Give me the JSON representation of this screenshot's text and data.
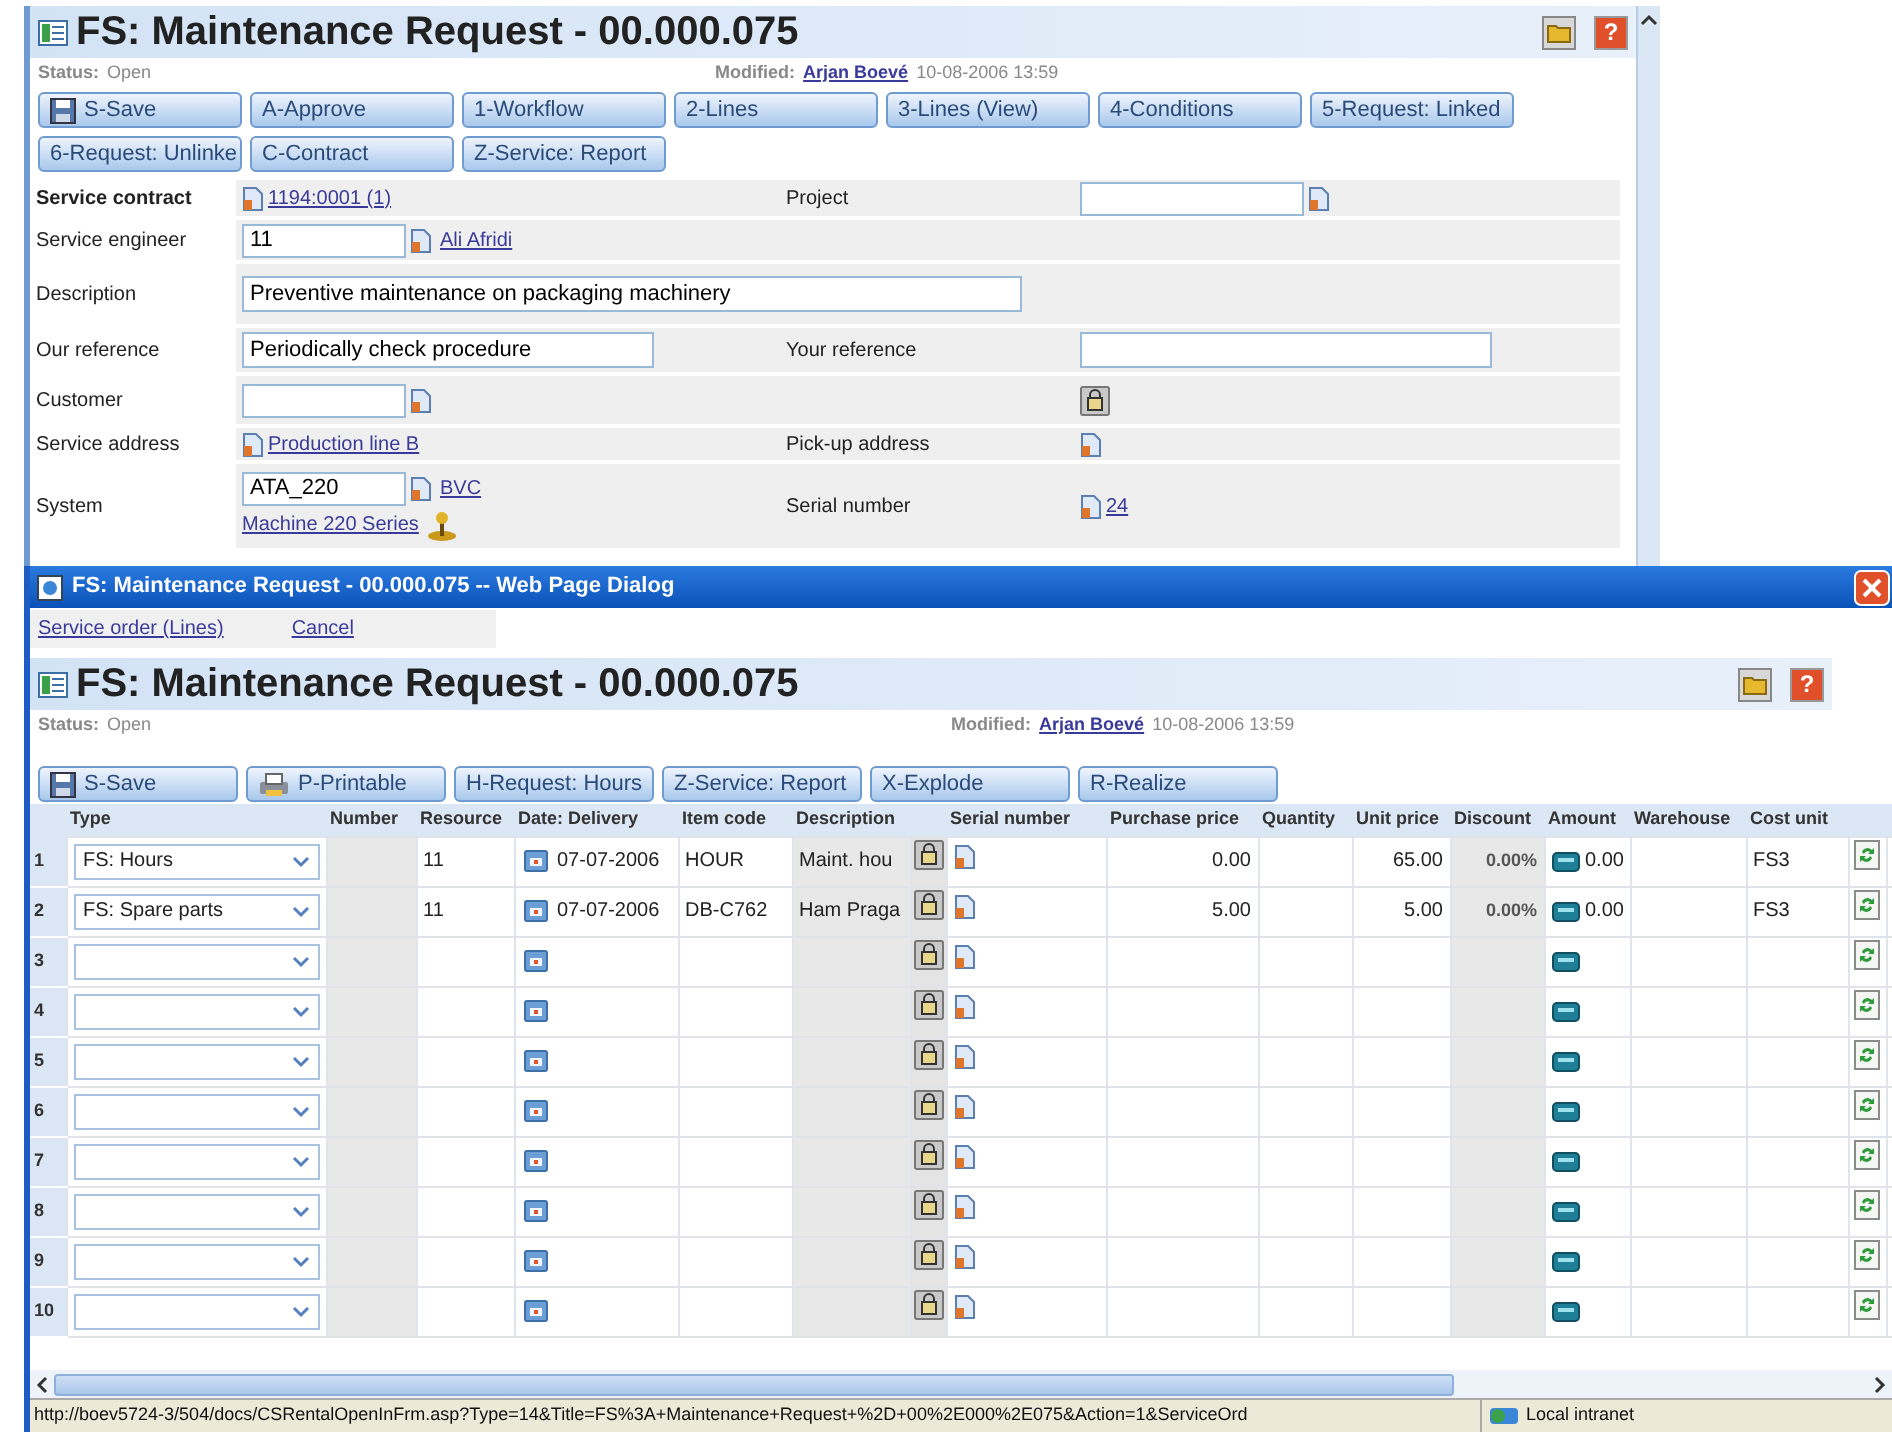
{
  "main_window": {
    "title": "FS: Maintenance Request - 00.000.075",
    "help_glyph": "?",
    "status_label": "Status:",
    "status": "Open",
    "modified_label": "Modified:",
    "modified_by": "Arjan Boevé",
    "modified_at": "10-08-2006 13:59",
    "button_rows": [
      [
        {
          "label": "S-Save",
          "kind": "save"
        },
        {
          "label": "A-Approve",
          "kind": "plain"
        },
        {
          "label": "1-Workflow",
          "kind": "plain"
        },
        {
          "label": "2-Lines",
          "kind": "plain"
        },
        {
          "label": "3-Lines (View)",
          "kind": "plain"
        },
        {
          "label": "4-Conditions",
          "kind": "plain"
        },
        {
          "label": "5-Request: Linked",
          "kind": "plain"
        }
      ],
      [
        {
          "label": "6-Request: Unlinke",
          "kind": "plain"
        },
        {
          "label": "C-Contract",
          "kind": "plain"
        },
        {
          "label": "Z-Service: Report",
          "kind": "plain"
        }
      ]
    ],
    "form": [
      {
        "label": "Service contract",
        "emphasis": true,
        "value": {
          "kind": "link",
          "text": "1194:0001 (1)"
        },
        "right": {
          "label": "Project",
          "value": {
            "kind": "lookup"
          }
        }
      },
      {
        "label": "Service engineer",
        "emphasis": false,
        "value": {
          "kind": "lookup",
          "value": "11",
          "link": "Ali Afridi"
        }
      },
      {
        "label": "Description",
        "emphasis": false,
        "value": {
          "kind": "long_input",
          "value": "Preventive maintenance on packaging machinery"
        }
      },
      {
        "label": "Our reference",
        "emphasis": false,
        "value": {
          "kind": "input",
          "value": "Periodically check procedure"
        },
        "right": {
          "label": "Your reference",
          "value": {
            "kind": "input"
          }
        }
      },
      {
        "label": "Customer",
        "emphasis": false,
        "value": {
          "kind": "lookup"
        },
        "right": {
          "value": {
            "kind": "lock"
          }
        }
      },
      {
        "label": "Service address",
        "emphasis": false,
        "value": {
          "kind": "link",
          "text": "Production line B"
        },
        "right": {
          "label": "Pick-up address",
          "value": {
            "kind": "icon"
          }
        }
      },
      {
        "label": "System",
        "emphasis": false,
        "value": {
          "kind": "lookup",
          "value": "ATA_220",
          "link": "BVC",
          "sublink": "Machine 220 Series"
        },
        "right": {
          "label": "Serial number",
          "value": {
            "kind": "link",
            "text": "24"
          }
        }
      }
    ]
  },
  "dialog": {
    "title": "FS: Maintenance Request - 00.000.075 -- Web Page Dialog",
    "menu": [
      {
        "label": "Service order (Lines)"
      },
      {
        "label": "Cancel"
      }
    ],
    "page_title": "FS: Maintenance Request - 00.000.075",
    "help_glyph": "?",
    "status_label": "Status:",
    "status": "Open",
    "modified_label": "Modified:",
    "modified_by": "Arjan Boevé",
    "modified_at": "10-08-2006 13:59",
    "buttons": [
      {
        "label": "S-Save",
        "kind": "save"
      },
      {
        "label": "P-Printable",
        "kind": "print"
      },
      {
        "label": "H-Request: Hours",
        "kind": "plain"
      },
      {
        "label": "Z-Service: Report",
        "kind": "plain"
      },
      {
        "label": "X-Explode",
        "kind": "plain"
      },
      {
        "label": "R-Realize",
        "kind": "plain"
      }
    ],
    "table": {
      "columns": [
        "Type",
        "Number",
        "Resource",
        "Date: Delivery",
        "Item code",
        "Description",
        "Serial number",
        "Purchase price",
        "Quantity",
        "Unit price",
        "Discount",
        "Amount",
        "Warehouse",
        "Cost unit"
      ],
      "rows": [
        {
          "index": "1",
          "type": "FS: Hours",
          "resource": "11",
          "date": "07-07-2006",
          "item_code": "HOUR",
          "description": "Maint. hou",
          "purchase_price": "0.00",
          "unit_price": "65.00",
          "discount": "0.00%",
          "amount": "0.00",
          "cost_unit": "FS3"
        },
        {
          "index": "2",
          "type": "FS: Spare parts",
          "resource": "11",
          "date": "07-07-2006",
          "item_code": "DB-C762",
          "description": "Ham Praga",
          "purchase_price": "5.00",
          "unit_price": "5.00",
          "discount": "0.00%",
          "amount": "0.00",
          "cost_unit": "FS3"
        },
        {
          "index": "3"
        },
        {
          "index": "4"
        },
        {
          "index": "5"
        },
        {
          "index": "6"
        },
        {
          "index": "7"
        },
        {
          "index": "8"
        },
        {
          "index": "9"
        },
        {
          "index": "10"
        }
      ]
    },
    "status_bar": {
      "url": "http://boev5724-3/504/docs/CSRentalOpenInFrm.asp?Type=14&Title=FS%3A+Maintenance+Request+%2D+00%2E000%2E075&Action=1&ServiceOrd",
      "zone": "Local intranet"
    }
  }
}
